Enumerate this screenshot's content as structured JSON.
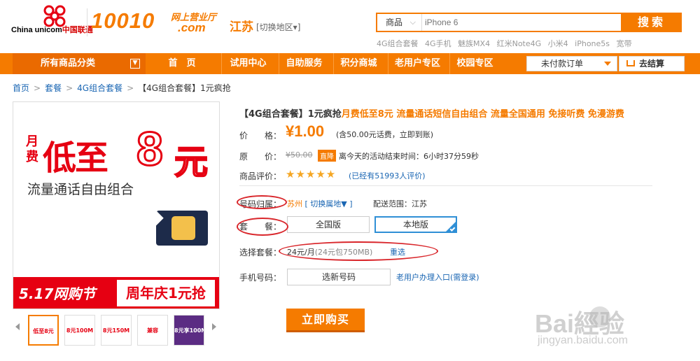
{
  "header": {
    "logo_text": "China unicom中国联通",
    "logo_word_a": "China",
    "logo_word_b": "unicom",
    "logo_word_c": "中国联通",
    "brand_number": "10010",
    "brand_tag_top": "网上营业厅",
    "brand_tag_bottom": ".com",
    "region": "江苏",
    "region_switch": "[切换地区▾]",
    "search": {
      "category": "商品",
      "placeholder": "iPhone 6",
      "button_label": "搜索",
      "hot_keywords": [
        "4G组合套餐",
        "4G手机",
        "魅族MX4",
        "红米Note4G",
        "小米4",
        "iPhone5s",
        "宽带"
      ]
    }
  },
  "nav": {
    "all_categories": "所有商品分类",
    "items": [
      "首　页",
      "试用中心",
      "自助服务",
      "积分商城",
      "老用户专区",
      "校园专区"
    ],
    "unpaid_orders": "未付款订单",
    "checkout": "去结算"
  },
  "breadcrumb": [
    "首页",
    "套餐",
    "4G组合套餐",
    "【4G组合套餐】1元疯抢"
  ],
  "product_image": {
    "monthly": "月费",
    "headline": "低至",
    "amount": "8",
    "unit": "元",
    "subtitle": "流量通话自由组合",
    "banner_left": "5.17网购节",
    "banner_right": "周年庆1元抢",
    "thumbnails": [
      "低至8元",
      "8元100M",
      "8元150M",
      "兼容",
      "8元享100M"
    ]
  },
  "product": {
    "title_prefix": "【4G组合套餐】1元疯抢",
    "title_highlight": "月费低至8元 流量通话短信自由组合 流量全国通用 免接听费 免漫游费",
    "price_label": "价　　格：",
    "price": "¥1.00",
    "price_note": "(含50.00元话费，立即到账)",
    "original_label": "原　　价：",
    "original_price": "¥50.00",
    "discount_badge": "直降",
    "countdown": "离今天的活动结束时间：6小时37分59秒",
    "rating_label": "商品评价：",
    "stars": 5,
    "rating_stars_text": "★★★★★",
    "review_count": "(已经有51993人评价)",
    "number_region_label": "号码归属：",
    "number_region": "苏州",
    "switch_region": "[ 切换属地▼ ]",
    "delivery_label": "配送范围：",
    "delivery": "江苏",
    "package_label": "套　　餐：",
    "packages": [
      "全国版",
      "本地版"
    ],
    "selected_package_index": 1,
    "plan_label": "选择套餐：",
    "plan_value": "24元/月",
    "plan_detail": "(24元包750MB)",
    "reselect": "重选",
    "phone_label": "手机号码：",
    "phone_button": "选新号码",
    "old_user_link": "老用户办理入口(需登录)",
    "buy_button": "立即购买"
  },
  "watermark": {
    "line1": "Bai經验",
    "line2": "jingyan.baidu.com"
  },
  "colors": {
    "brand_orange": "#f57b00",
    "unicom_red": "#e60012",
    "link_blue": "#1a66b3",
    "selected_blue": "#2f8fd6",
    "annotation_red": "#d9262b"
  }
}
